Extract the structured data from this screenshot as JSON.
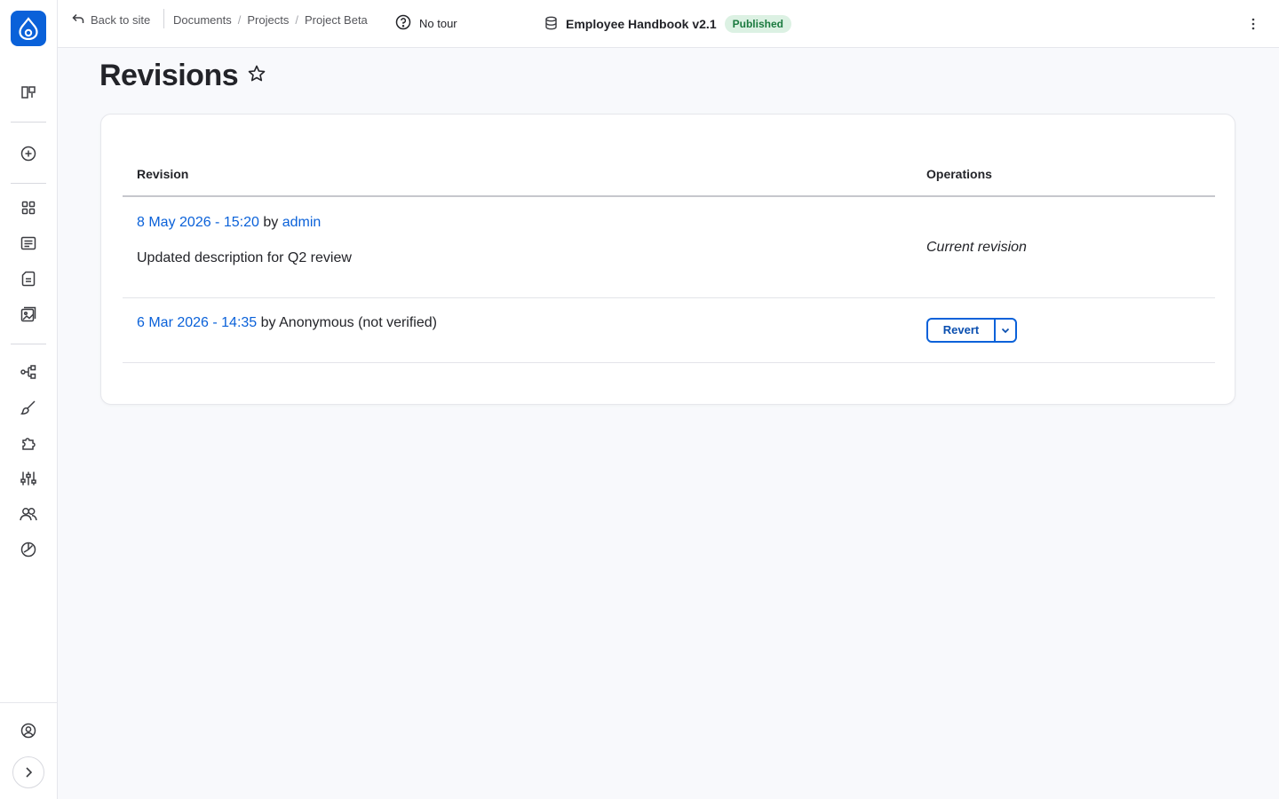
{
  "topbar": {
    "back_label": "Back to site",
    "breadcrumb": [
      "Documents",
      "Projects",
      "Project Beta"
    ],
    "breadcrumb_separator": "/",
    "tour_label": "No tour",
    "document_title": "Employee Handbook v2.1",
    "status_badge": "Published"
  },
  "page": {
    "title": "Revisions"
  },
  "table": {
    "headers": {
      "revision": "Revision",
      "operations": "Operations"
    },
    "rows": [
      {
        "date": "8 May 2026 - 15:20",
        "by": "by",
        "author": "admin",
        "message": "Updated description for Q2 review",
        "operation": "Current revision"
      },
      {
        "date": "6 Mar 2026 - 14:35",
        "by": "by",
        "author": "Anonymous (not verified)",
        "operation_button": "Revert"
      }
    ]
  },
  "sidebar": {
    "icons": [
      "drupal-logo-icon",
      "shortcuts-icon",
      "add-content-icon",
      "dashboard-icon",
      "content-icon",
      "files-icon",
      "media-icon",
      "structure-icon",
      "appearance-icon",
      "extend-icon",
      "configuration-icon",
      "people-icon",
      "reports-icon",
      "user-account-icon",
      "expand-sidebar-icon"
    ]
  },
  "colors": {
    "accent": "#0a61d9",
    "badge_bg": "#dcf1e3",
    "badge_text": "#1b7a3f",
    "page_bg": "#f8f9fc"
  }
}
